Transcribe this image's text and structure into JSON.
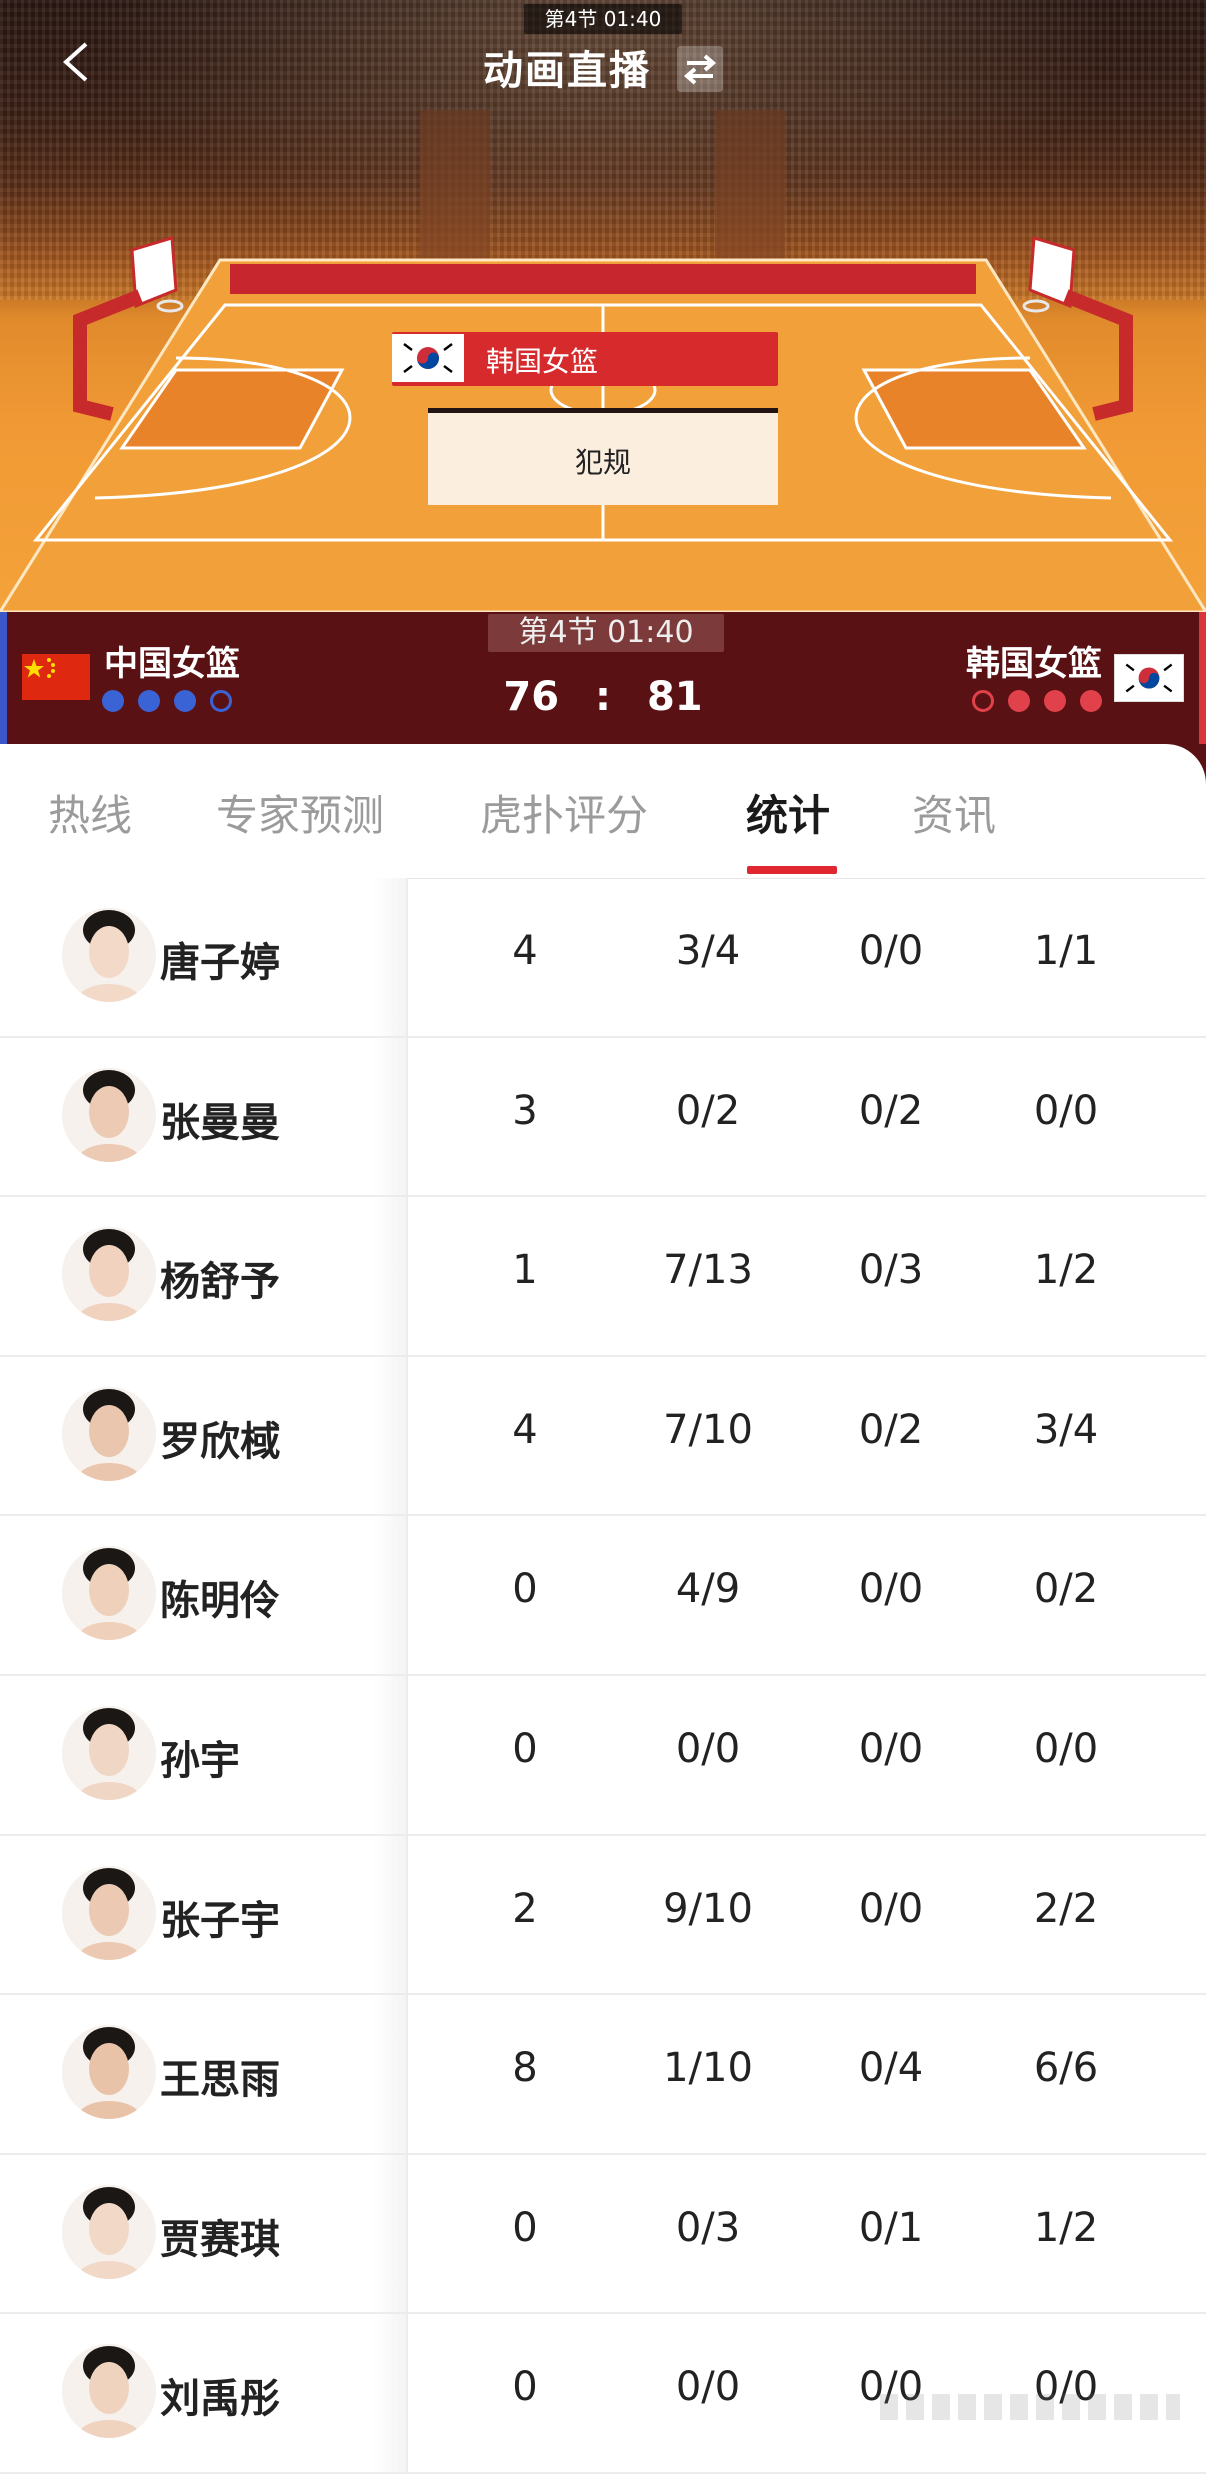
{
  "header": {
    "quarter_tag": "第4节  01:40",
    "title": "动画直播",
    "event_team": "韩国女篮",
    "event_text": "犯规"
  },
  "scoreboard": {
    "home": {
      "name": "中国女篮",
      "timeouts": [
        "filled",
        "filled",
        "filled",
        "empty"
      ],
      "dot_color": "#3a63d6"
    },
    "away": {
      "name": "韩国女篮",
      "timeouts": [
        "empty",
        "filled",
        "filled",
        "filled"
      ],
      "dot_color": "#e0414a"
    },
    "period": "第4节  01:40",
    "home_score": "76",
    "separator": ":",
    "away_score": "81"
  },
  "tabs": [
    {
      "label": "热线",
      "active": false
    },
    {
      "label": "专家预测",
      "active": false
    },
    {
      "label": "虎扑评分",
      "active": false
    },
    {
      "label": "统计",
      "active": true
    },
    {
      "label": "资讯",
      "active": false
    }
  ],
  "players": [
    {
      "name": "唐子婷",
      "c1": "4",
      "c2": "3/4",
      "c3": "0/0",
      "c4": "1/1"
    },
    {
      "name": "张曼曼",
      "c1": "3",
      "c2": "0/2",
      "c3": "0/2",
      "c4": "0/0"
    },
    {
      "name": "杨舒予",
      "c1": "1",
      "c2": "7/13",
      "c3": "0/3",
      "c4": "1/2"
    },
    {
      "name": "罗欣棫",
      "c1": "4",
      "c2": "7/10",
      "c3": "0/2",
      "c4": "3/4"
    },
    {
      "name": "陈明伶",
      "c1": "0",
      "c2": "4/9",
      "c3": "0/0",
      "c4": "0/2"
    },
    {
      "name": "孙宇",
      "c1": "0",
      "c2": "0/0",
      "c3": "0/0",
      "c4": "0/0"
    },
    {
      "name": "张子宇",
      "c1": "2",
      "c2": "9/10",
      "c3": "0/0",
      "c4": "2/2"
    },
    {
      "name": "王思雨",
      "c1": "8",
      "c2": "1/10",
      "c3": "0/4",
      "c4": "6/6"
    },
    {
      "name": "贾赛琪",
      "c1": "0",
      "c2": "0/3",
      "c3": "0/1",
      "c4": "1/2"
    },
    {
      "name": "刘禹彤",
      "c1": "0",
      "c2": "0/0",
      "c3": "0/0",
      "c4": "0/0"
    }
  ],
  "colors": {
    "accent": "#e0262e",
    "scoreboard_bg": "#5a1114"
  }
}
